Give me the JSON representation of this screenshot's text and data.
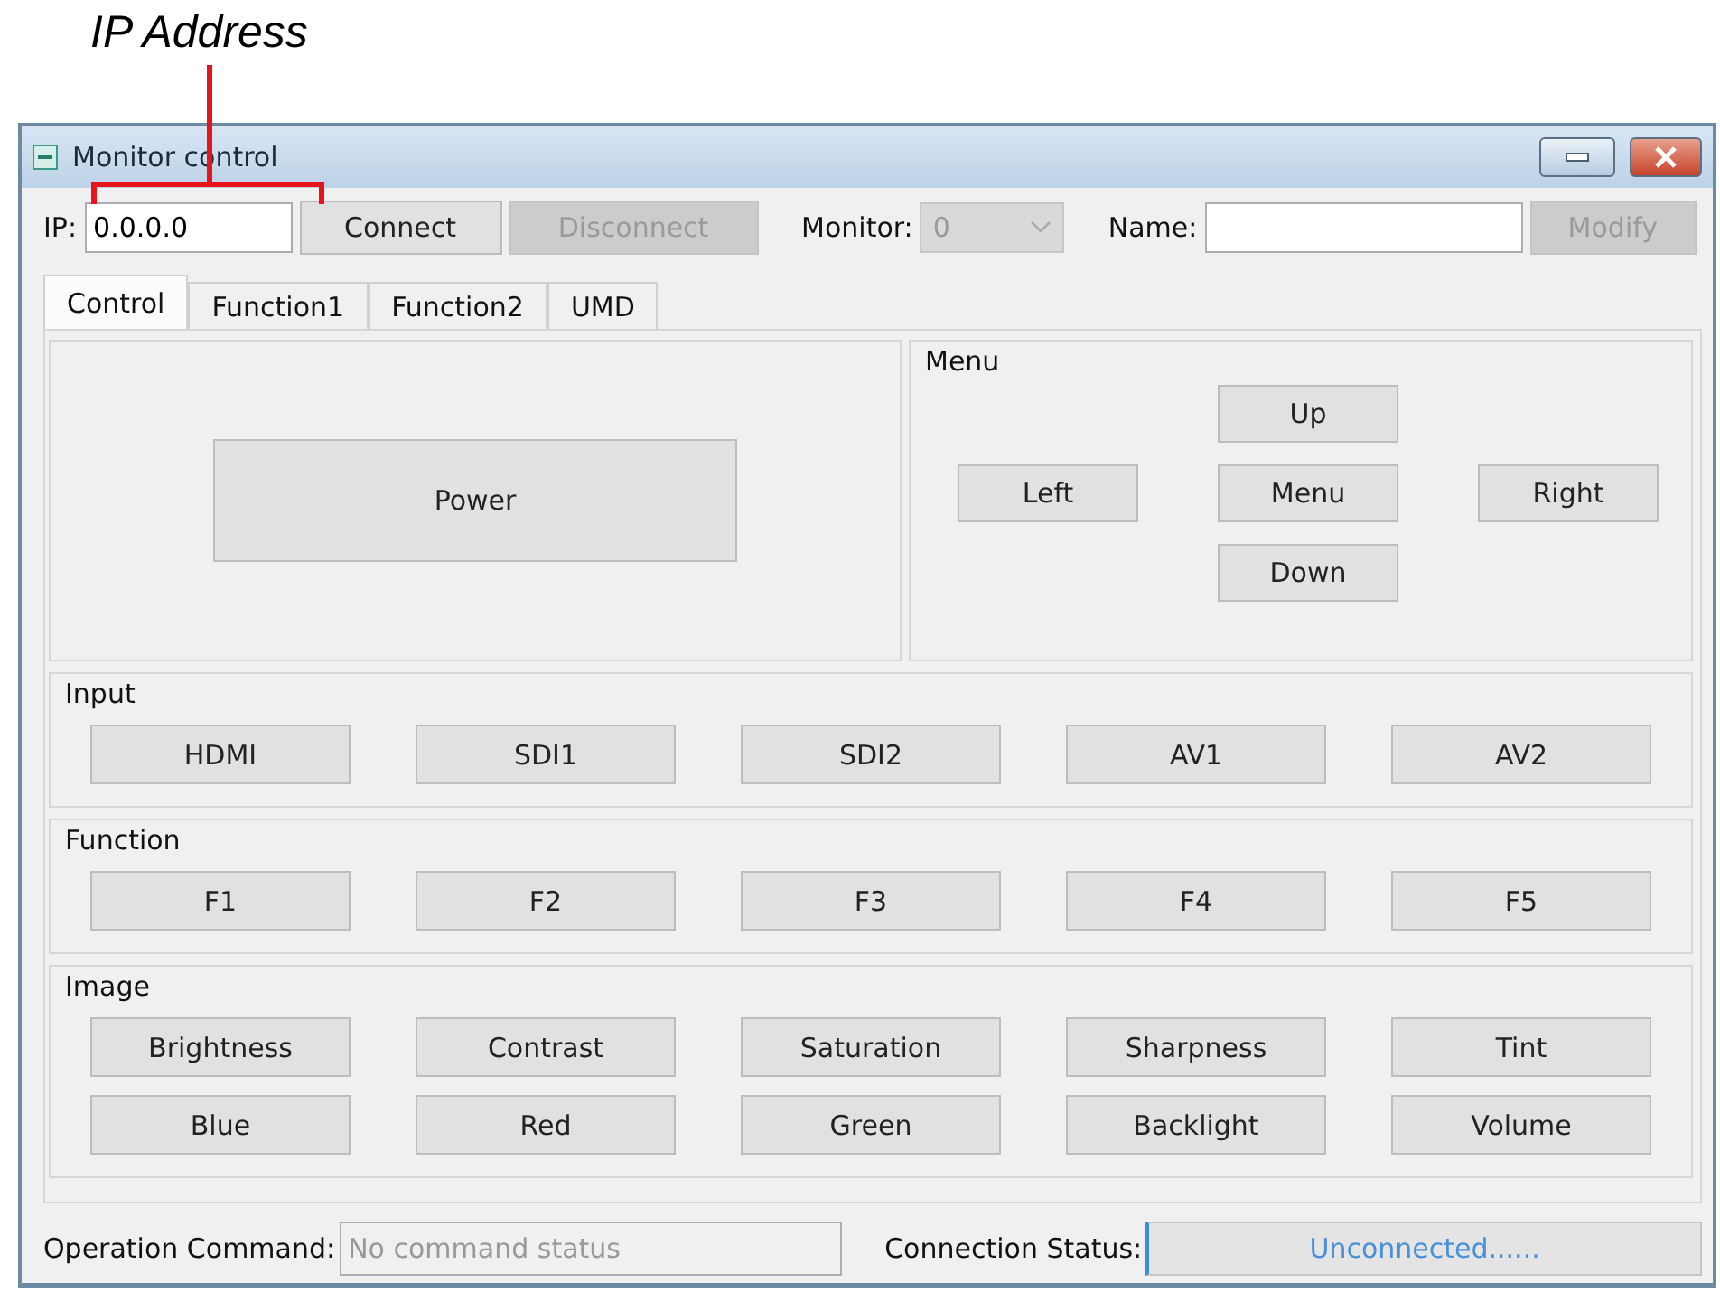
{
  "annotation": {
    "label": "IP Address"
  },
  "window": {
    "title": "Monitor control"
  },
  "toolbar": [
    {
      "kind": "label",
      "text": "IP:"
    },
    {
      "kind": "input",
      "value": "0.0.0.0"
    },
    {
      "kind": "button",
      "label": "Connect",
      "disabled": false
    },
    {
      "kind": "button",
      "label": "Disconnect",
      "disabled": true
    },
    {
      "kind": "label",
      "text": "Monitor:"
    },
    {
      "kind": "select",
      "value": "0",
      "disabled": true
    },
    {
      "kind": "label",
      "text": "Name:"
    },
    {
      "kind": "input"
    },
    {
      "kind": "button",
      "label": "Modify",
      "disabled": true
    }
  ],
  "tabs": [
    {
      "label": "Control",
      "selected": true
    },
    {
      "label": "Function1",
      "selected": false
    },
    {
      "label": "Function2",
      "selected": false
    },
    {
      "label": "UMD",
      "selected": false
    }
  ],
  "power": {
    "label": "Power"
  },
  "menu": {
    "title": "Menu",
    "up": "Up",
    "left": "Left",
    "center": "Menu",
    "right": "Right",
    "down": "Down"
  },
  "groups": [
    {
      "title": "Input",
      "buttons": [
        "HDMI",
        "SDI1",
        "SDI2",
        "AV1",
        "AV2"
      ]
    },
    {
      "title": "Function",
      "buttons": [
        "F1",
        "F2",
        "F3",
        "F4",
        "F5"
      ]
    },
    {
      "title": "Image",
      "buttons": [
        "Brightness",
        "Contrast",
        "Saturation",
        "Sharpness",
        "Tint",
        "Blue",
        "Red",
        "Green",
        "Backlight",
        "Volume"
      ]
    }
  ],
  "status_bar": {
    "operation_label": "Operation Command:",
    "operation_placeholder": "No command status",
    "connection_label": "Connection Status:",
    "connection_value": "Unconnected......"
  }
}
